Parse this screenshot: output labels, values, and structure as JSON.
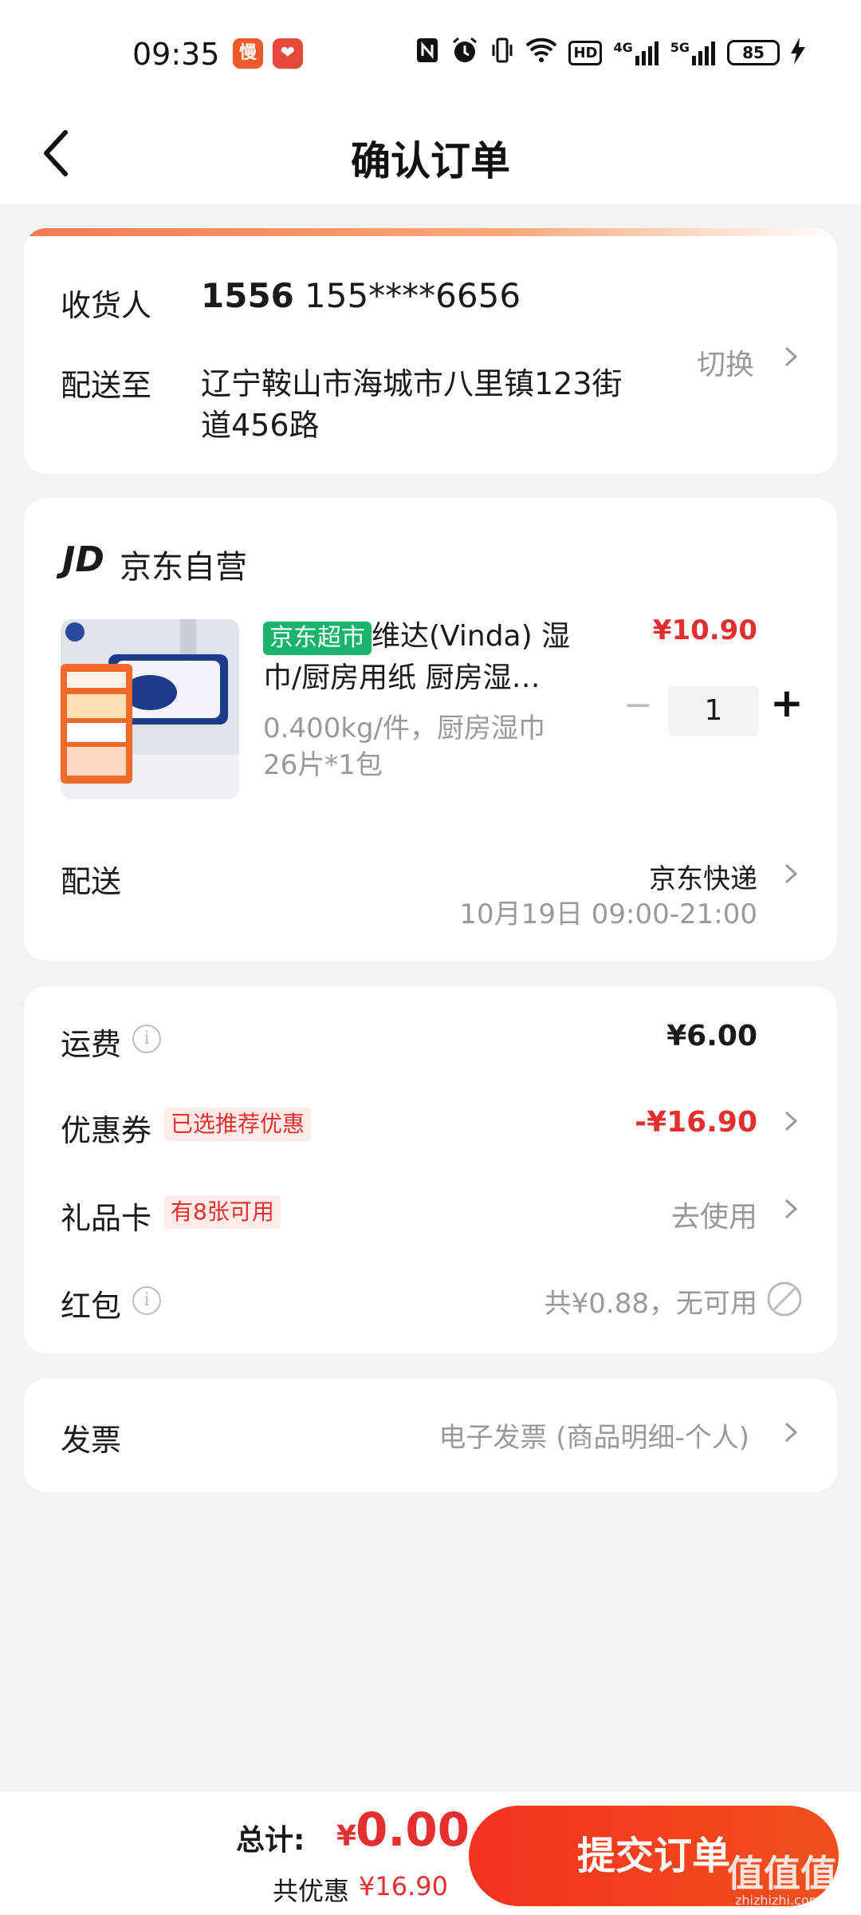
{
  "status_bar": {
    "time": "09:35",
    "app_badge_1": "慢",
    "app_badge_2": "❤",
    "icons": [
      "nfc-icon",
      "alarm-icon",
      "vibrate-icon",
      "wifi-icon",
      "hd-icon",
      "signal-4g-icon",
      "signal-5g-icon"
    ],
    "hd_label": "HD",
    "net1": "4G",
    "net2": "5G",
    "battery": "85"
  },
  "nav": {
    "title": "确认订单"
  },
  "address": {
    "receiver_label": "收货人",
    "receiver_name": "1556",
    "receiver_phone": "155****6656",
    "deliver_label": "配送至",
    "address_line1": "辽宁鞍山市海城市八里镇123街",
    "address_line2": "道456路",
    "switch_label": "切换"
  },
  "shop": {
    "logo": "JD",
    "name": "京东自营",
    "product": {
      "tag": "京东超市",
      "title_line1": "维达(Vinda) 湿",
      "title_line2": "巾/厨房用纸 厨房湿…",
      "spec_line1": "0.400kg/件，厨房湿巾",
      "spec_line2": "26片*1包",
      "price": "¥10.90",
      "quantity": "1",
      "minus": "−",
      "plus": "+"
    },
    "delivery_label": "配送",
    "delivery_method": "京东快递",
    "delivery_time": "10月19日 09:00-21:00"
  },
  "fees": {
    "shipping_label": "运费",
    "shipping_value": "¥6.00",
    "coupon_label": "优惠券",
    "coupon_tag": "已选推荐优惠",
    "coupon_value": "-¥16.90",
    "giftcard_label": "礼品卡",
    "giftcard_tag": "有8张可用",
    "giftcard_value": "去使用",
    "redpacket_label": "红包",
    "redpacket_value": "共¥0.88，无可用"
  },
  "invoice": {
    "label": "发票",
    "value": "电子发票 (商品明细-个人)"
  },
  "bottom": {
    "total_label": "总计:",
    "currency": "¥",
    "total_value": "0.00",
    "discount_label": "共优惠",
    "discount_value": "¥16.90",
    "submit_label": "提交订单"
  },
  "watermark": {
    "text": "值值值",
    "url": "zhizhizhi.com"
  },
  "colors": {
    "accent_red": "#e52f2f",
    "submit_bg": "#f5331f",
    "tag_green": "#19b36b"
  }
}
